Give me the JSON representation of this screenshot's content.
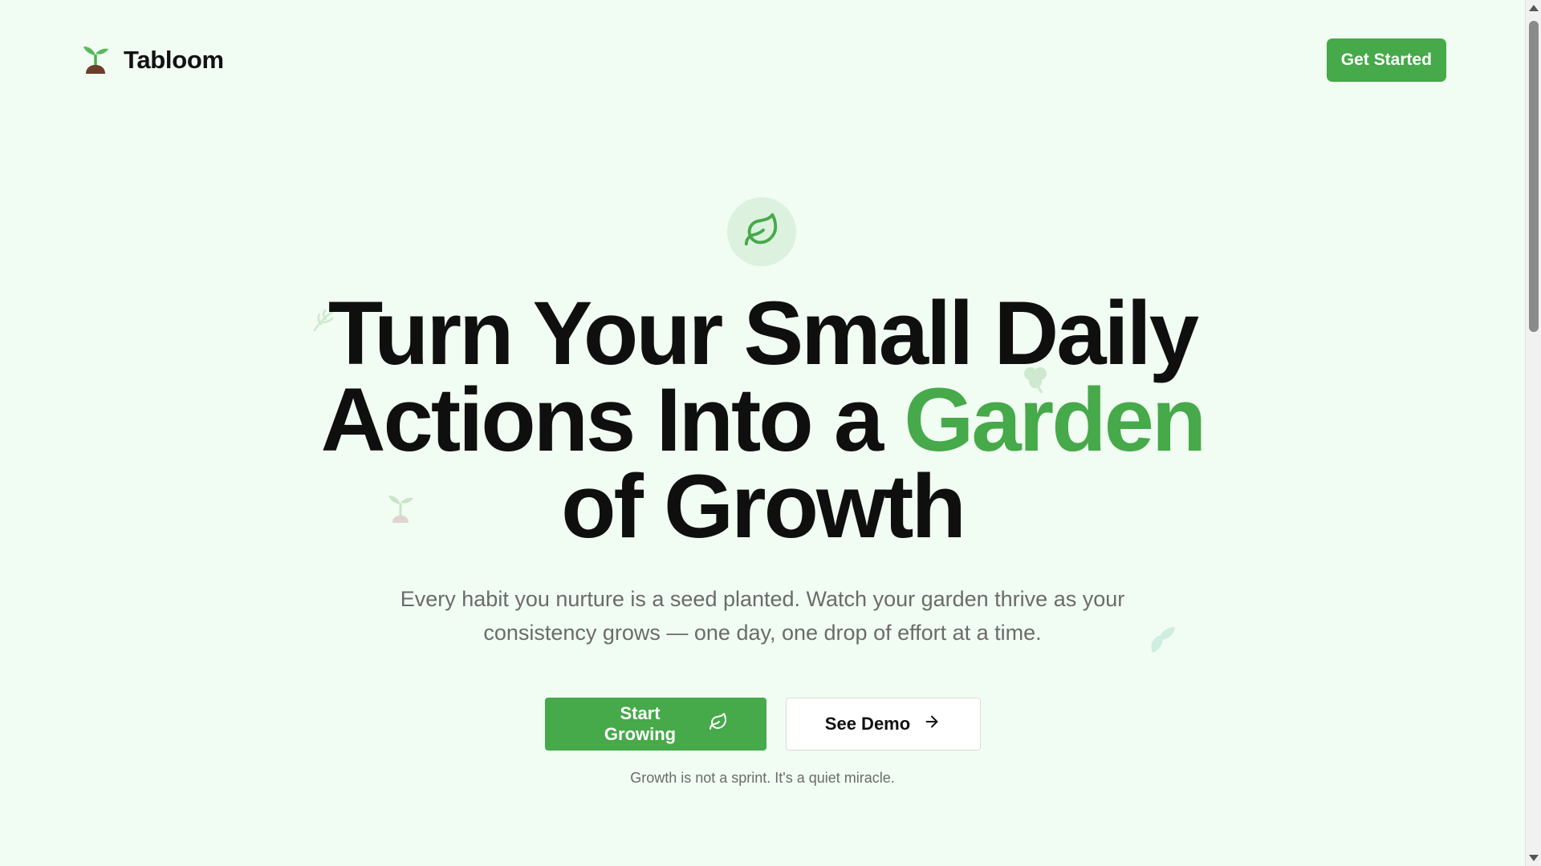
{
  "header": {
    "brand_name": "Tabloom",
    "cta_label": "Get Started"
  },
  "hero": {
    "title_line1": "Turn Your Small Daily",
    "title_line2_prefix": "Actions Into a ",
    "title_line2_accent": "Garden",
    "title_line3": "of Growth",
    "subtitle_line1": "Every habit you nurture is a seed planted. Watch your garden thrive as your",
    "subtitle_line2": "consistency grows — one day, one drop of effort at a time.",
    "primary_cta": "Start Growing",
    "secondary_cta": "See Demo",
    "tagline": "Growth is not a sprint. It's a quiet miracle."
  },
  "colors": {
    "background": "#f1fcf2",
    "accent": "#46a94a",
    "badge_bg": "#dcf1de",
    "text": "#0f0f0f",
    "muted": "#6b6b6b"
  },
  "icons": {
    "logo": "seedling-icon",
    "badge": "leaf-icon",
    "primary_cta": "leaf-icon",
    "secondary_cta": "arrow-right-icon"
  }
}
